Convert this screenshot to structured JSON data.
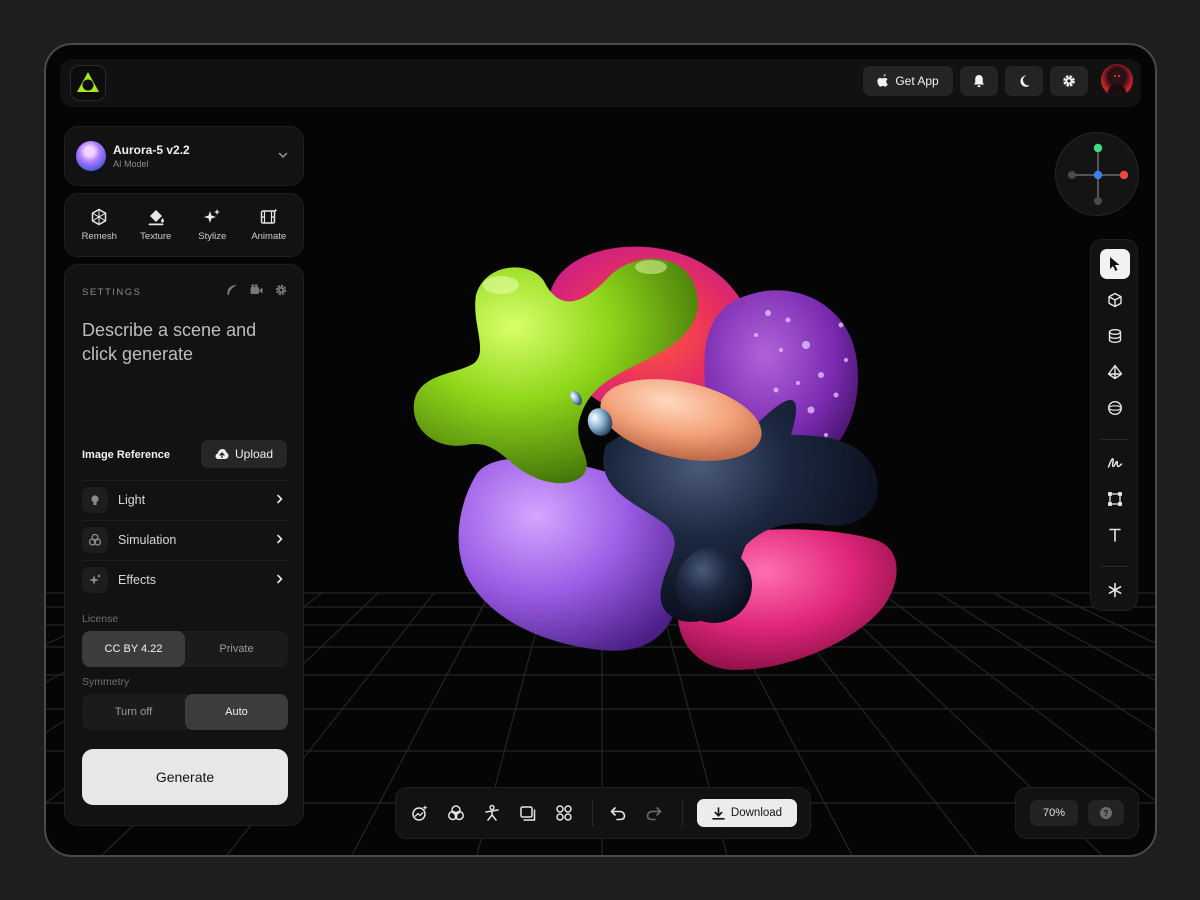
{
  "topbar": {
    "get_app_label": "Get App",
    "icons": [
      "apple-icon",
      "bell-icon",
      "moon-icon",
      "gear-icon"
    ]
  },
  "model": {
    "name": "Aurora-5 v2.2",
    "subtitle": "AI Model"
  },
  "tools": [
    {
      "label": "Remesh",
      "icon": "remesh-icon"
    },
    {
      "label": "Texture",
      "icon": "paint-bucket-icon"
    },
    {
      "label": "Stylize",
      "icon": "sparkles-icon"
    },
    {
      "label": "Animate",
      "icon": "film-icon"
    }
  ],
  "settings": {
    "title": "SETTINGS",
    "prompt": "Describe a scene and click generate",
    "image_reference": "Image Reference",
    "upload_label": "Upload",
    "rows": [
      {
        "label": "Light",
        "icon": "bulb-icon"
      },
      {
        "label": "Simulation",
        "icon": "circles-icon"
      },
      {
        "label": "Effects",
        "icon": "sparkle-icon"
      }
    ],
    "license_label": "License",
    "license_options": [
      "CC BY 4.22",
      "Private"
    ],
    "license_selected": "CC BY 4.22",
    "symmetry_label": "Symmetry",
    "symmetry_options": [
      "Turn off",
      "Auto"
    ],
    "symmetry_selected": "Auto",
    "generate_label": "Generate"
  },
  "bottom_toolbar": {
    "download_label": "Download"
  },
  "zoom": {
    "value": "70%",
    "help": "?"
  },
  "colors": {
    "accent_green": "#a6e61c",
    "blob_purple": "#9b5de5",
    "blob_pink": "#e0267a",
    "blob_navy": "#172033",
    "blob_peach": "#f3a27a",
    "axis_green": "#3ddc84",
    "axis_red": "#ef4444",
    "axis_blue": "#3b82f6"
  }
}
